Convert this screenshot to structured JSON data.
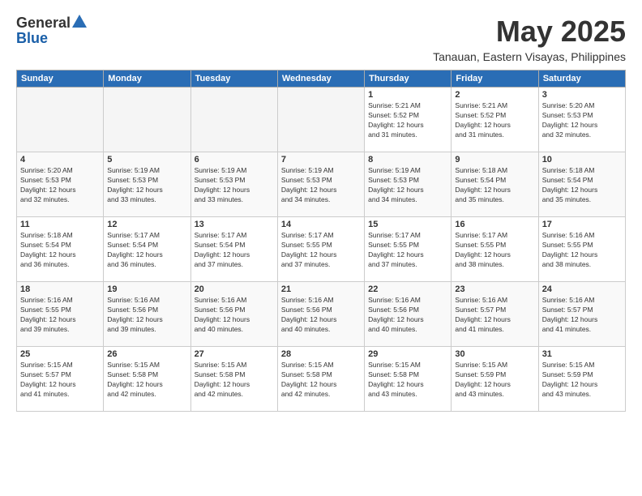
{
  "logo": {
    "general": "General",
    "blue": "Blue"
  },
  "title": "May 2025",
  "subtitle": "Tanauan, Eastern Visayas, Philippines",
  "days_header": [
    "Sunday",
    "Monday",
    "Tuesday",
    "Wednesday",
    "Thursday",
    "Friday",
    "Saturday"
  ],
  "weeks": [
    [
      {
        "day": "",
        "info": ""
      },
      {
        "day": "",
        "info": ""
      },
      {
        "day": "",
        "info": ""
      },
      {
        "day": "",
        "info": ""
      },
      {
        "day": "1",
        "info": "Sunrise: 5:21 AM\nSunset: 5:52 PM\nDaylight: 12 hours\nand 31 minutes."
      },
      {
        "day": "2",
        "info": "Sunrise: 5:21 AM\nSunset: 5:52 PM\nDaylight: 12 hours\nand 31 minutes."
      },
      {
        "day": "3",
        "info": "Sunrise: 5:20 AM\nSunset: 5:53 PM\nDaylight: 12 hours\nand 32 minutes."
      }
    ],
    [
      {
        "day": "4",
        "info": "Sunrise: 5:20 AM\nSunset: 5:53 PM\nDaylight: 12 hours\nand 32 minutes."
      },
      {
        "day": "5",
        "info": "Sunrise: 5:19 AM\nSunset: 5:53 PM\nDaylight: 12 hours\nand 33 minutes."
      },
      {
        "day": "6",
        "info": "Sunrise: 5:19 AM\nSunset: 5:53 PM\nDaylight: 12 hours\nand 33 minutes."
      },
      {
        "day": "7",
        "info": "Sunrise: 5:19 AM\nSunset: 5:53 PM\nDaylight: 12 hours\nand 34 minutes."
      },
      {
        "day": "8",
        "info": "Sunrise: 5:19 AM\nSunset: 5:53 PM\nDaylight: 12 hours\nand 34 minutes."
      },
      {
        "day": "9",
        "info": "Sunrise: 5:18 AM\nSunset: 5:54 PM\nDaylight: 12 hours\nand 35 minutes."
      },
      {
        "day": "10",
        "info": "Sunrise: 5:18 AM\nSunset: 5:54 PM\nDaylight: 12 hours\nand 35 minutes."
      }
    ],
    [
      {
        "day": "11",
        "info": "Sunrise: 5:18 AM\nSunset: 5:54 PM\nDaylight: 12 hours\nand 36 minutes."
      },
      {
        "day": "12",
        "info": "Sunrise: 5:17 AM\nSunset: 5:54 PM\nDaylight: 12 hours\nand 36 minutes."
      },
      {
        "day": "13",
        "info": "Sunrise: 5:17 AM\nSunset: 5:54 PM\nDaylight: 12 hours\nand 37 minutes."
      },
      {
        "day": "14",
        "info": "Sunrise: 5:17 AM\nSunset: 5:55 PM\nDaylight: 12 hours\nand 37 minutes."
      },
      {
        "day": "15",
        "info": "Sunrise: 5:17 AM\nSunset: 5:55 PM\nDaylight: 12 hours\nand 37 minutes."
      },
      {
        "day": "16",
        "info": "Sunrise: 5:17 AM\nSunset: 5:55 PM\nDaylight: 12 hours\nand 38 minutes."
      },
      {
        "day": "17",
        "info": "Sunrise: 5:16 AM\nSunset: 5:55 PM\nDaylight: 12 hours\nand 38 minutes."
      }
    ],
    [
      {
        "day": "18",
        "info": "Sunrise: 5:16 AM\nSunset: 5:55 PM\nDaylight: 12 hours\nand 39 minutes."
      },
      {
        "day": "19",
        "info": "Sunrise: 5:16 AM\nSunset: 5:56 PM\nDaylight: 12 hours\nand 39 minutes."
      },
      {
        "day": "20",
        "info": "Sunrise: 5:16 AM\nSunset: 5:56 PM\nDaylight: 12 hours\nand 40 minutes."
      },
      {
        "day": "21",
        "info": "Sunrise: 5:16 AM\nSunset: 5:56 PM\nDaylight: 12 hours\nand 40 minutes."
      },
      {
        "day": "22",
        "info": "Sunrise: 5:16 AM\nSunset: 5:56 PM\nDaylight: 12 hours\nand 40 minutes."
      },
      {
        "day": "23",
        "info": "Sunrise: 5:16 AM\nSunset: 5:57 PM\nDaylight: 12 hours\nand 41 minutes."
      },
      {
        "day": "24",
        "info": "Sunrise: 5:16 AM\nSunset: 5:57 PM\nDaylight: 12 hours\nand 41 minutes."
      }
    ],
    [
      {
        "day": "25",
        "info": "Sunrise: 5:15 AM\nSunset: 5:57 PM\nDaylight: 12 hours\nand 41 minutes."
      },
      {
        "day": "26",
        "info": "Sunrise: 5:15 AM\nSunset: 5:58 PM\nDaylight: 12 hours\nand 42 minutes."
      },
      {
        "day": "27",
        "info": "Sunrise: 5:15 AM\nSunset: 5:58 PM\nDaylight: 12 hours\nand 42 minutes."
      },
      {
        "day": "28",
        "info": "Sunrise: 5:15 AM\nSunset: 5:58 PM\nDaylight: 12 hours\nand 42 minutes."
      },
      {
        "day": "29",
        "info": "Sunrise: 5:15 AM\nSunset: 5:58 PM\nDaylight: 12 hours\nand 43 minutes."
      },
      {
        "day": "30",
        "info": "Sunrise: 5:15 AM\nSunset: 5:59 PM\nDaylight: 12 hours\nand 43 minutes."
      },
      {
        "day": "31",
        "info": "Sunrise: 5:15 AM\nSunset: 5:59 PM\nDaylight: 12 hours\nand 43 minutes."
      }
    ]
  ]
}
